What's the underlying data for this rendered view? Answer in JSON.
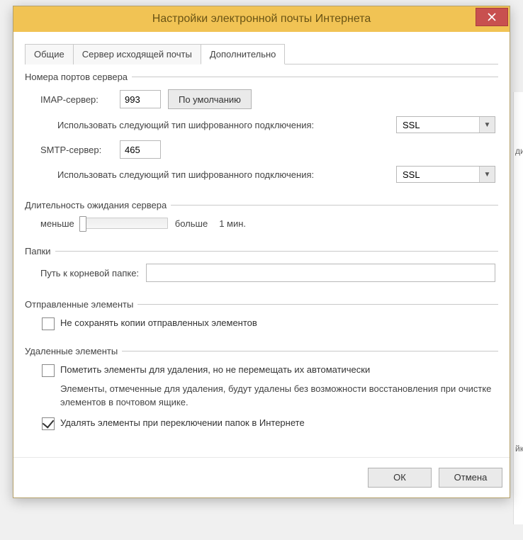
{
  "window": {
    "title": "Настройки электронной почты Интернета"
  },
  "tabs": {
    "general": "Общие",
    "outgoing": "Сервер исходящей почты",
    "advanced": "Дополнительно"
  },
  "ports": {
    "legend": "Номера портов сервера",
    "imap_label": "IMAP-сервер:",
    "imap_value": "993",
    "default_btn": "По умолчанию",
    "encryption_label": "Использовать следующий тип шифрованного подключения:",
    "imap_enc": "SSL",
    "smtp_label": "SMTP-сервер:",
    "smtp_value": "465",
    "smtp_enc": "SSL"
  },
  "timeout": {
    "legend": "Длительность ожидания сервера",
    "less": "меньше",
    "more": "больше",
    "value": "1 мин."
  },
  "folders": {
    "legend": "Папки",
    "root_label": "Путь к корневой папке:",
    "root_value": ""
  },
  "sent": {
    "legend": "Отправленные элементы",
    "dont_save": "Не сохранять копии отправленных элементов",
    "dont_save_checked": false
  },
  "deleted": {
    "legend": "Удаленные элементы",
    "mark_label": "Пометить элементы для удаления, но не перемещать их автоматически",
    "mark_checked": false,
    "mark_desc": "Элементы, отмеченные для удаления, будут удалены без возможности восстановления при очистке элементов в почтовом ящике.",
    "purge_label": "Удалять элементы при переключении папок в Интернете",
    "purge_checked": true
  },
  "buttons": {
    "ok": "ОК",
    "cancel": "Отмена"
  },
  "bg": {
    "a": "ди",
    "b": "йк"
  }
}
